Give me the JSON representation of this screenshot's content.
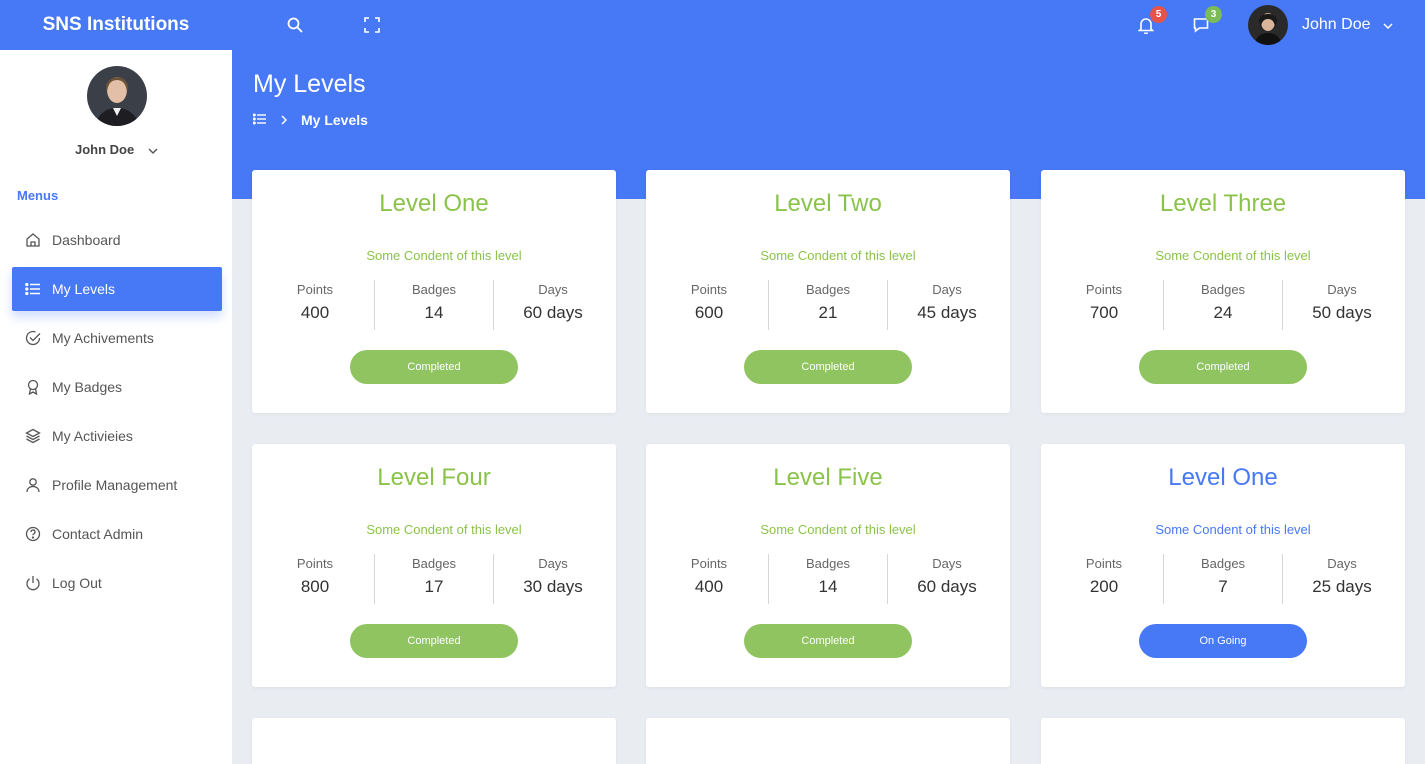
{
  "app": {
    "brand": "SNS Institutions"
  },
  "topbar": {
    "notifications_count": "5",
    "messages_count": "3",
    "user_name": "John Doe",
    "notif_color": "#e5534b",
    "msg_color": "#7cbb5a"
  },
  "sidebar": {
    "user_name": "John Doe",
    "menus_label": "Menus",
    "items": [
      {
        "label": "Dashboard",
        "icon": "home-icon"
      },
      {
        "label": "My Levels",
        "icon": "list-icon",
        "active": true
      },
      {
        "label": "My Achivements",
        "icon": "check-circle-icon"
      },
      {
        "label": "My Badges",
        "icon": "award-icon"
      },
      {
        "label": "My Activieies",
        "icon": "layers-icon"
      },
      {
        "label": "Profile Management",
        "icon": "user-icon"
      },
      {
        "label": "Contact Admin",
        "icon": "help-circle-icon"
      },
      {
        "label": "Log Out",
        "icon": "power-icon"
      }
    ]
  },
  "header": {
    "title": "My Levels",
    "breadcrumb_current": "My Levels"
  },
  "stat_labels": {
    "points": "Points",
    "badges": "Badges",
    "days": "Days"
  },
  "levels": [
    {
      "title": "Level One",
      "desc": "Some Condent of this level",
      "points": "400",
      "badges": "14",
      "days": "60 days",
      "status": "Completed"
    },
    {
      "title": "Level Two",
      "desc": "Some Condent of this level",
      "points": "600",
      "badges": "21",
      "days": "45 days",
      "status": "Completed"
    },
    {
      "title": "Level Three",
      "desc": "Some Condent of this level",
      "points": "700",
      "badges": "24",
      "days": "50 days",
      "status": "Completed"
    },
    {
      "title": "Level Four",
      "desc": "Some Condent of this level",
      "points": "800",
      "badges": "17",
      "days": "30 days",
      "status": "Completed"
    },
    {
      "title": "Level Five",
      "desc": "Some Condent of this level",
      "points": "400",
      "badges": "14",
      "days": "60 days",
      "status": "Completed"
    },
    {
      "title": "Level One",
      "desc": "Some Condent of this level",
      "points": "200",
      "badges": "7",
      "days": "25 days",
      "status": "On Going"
    }
  ],
  "colors": {
    "primary": "#4778f5",
    "success": "#8bc34a",
    "background": "#e9edf2"
  }
}
